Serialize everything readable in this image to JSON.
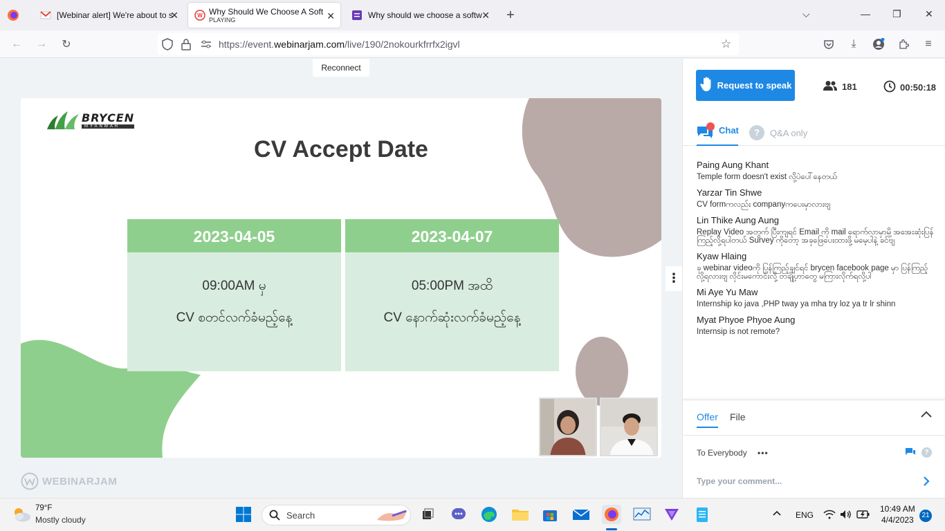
{
  "browser": {
    "tabs": [
      {
        "title": "[Webinar alert] We're about to s",
        "active": false
      },
      {
        "title": "Why Should We Choose A Softw",
        "subtitle": "PLAYING",
        "active": true
      },
      {
        "title": "Why should we choose a softw",
        "active": false
      }
    ],
    "url_prefix": "https://event.",
    "url_domain": "webinarjam.com",
    "url_path": "/live/190/2nokourkfrrfx2igvl"
  },
  "page": {
    "reconnect_label": "Reconnect",
    "slide": {
      "logo_text": "BRYCEN",
      "logo_sub": "MYANMAR",
      "title": "CV Accept Date",
      "boxes": [
        {
          "date": "2023-04-05",
          "line1": "09:00AM မှ",
          "line2": "CV စတင်လက်ခံမည့်နေ့"
        },
        {
          "date": "2023-04-07",
          "line1": "05:00PM အထိ",
          "line2": "CV နောက်ဆုံးလက်ခံမည့်နေ့"
        }
      ]
    },
    "watermark": "WEBINARJAM"
  },
  "panel": {
    "speak_label": "Request to speak",
    "attendee_count": "181",
    "timer": "00:50:18",
    "chat_tab": "Chat",
    "qa_tab": "Q&A only",
    "messages": [
      {
        "name": "Paing Aung Khant",
        "text": "Temple form doesn't exist လို့ပဲပေါ်နေတယ်"
      },
      {
        "name": "Yarzar Tin Shwe",
        "text": "CV formကလည်း companyကပေးမှာလားဗျ"
      },
      {
        "name": "Lin Thike Aung Aung",
        "text": "Replay Video အတွက် ပြီးကျရင် Email ကို mail ရောက်လာမှာမို့ အအေးဆုံးပြန်ကြည့်လို့ရပါတယ် Survey ကိုတော့ အခုဖြေပေးထားဖို့ မမေ့ပါနဲ့ ခင်ဗျ"
      },
      {
        "name": "Kyaw Hlaing",
        "text": "ခု webinar videoကို ပြန်ကြည့်ချင်ရင် brycen facebook page မှာ ပြန်ကြည့်လို့ရလားဗျ လိုင်းမကောင်းလို့ တချို့ဟာတွေ မကြားလိုက်ရလို့ပါ"
      },
      {
        "name": "Mi Aye Yu Maw",
        "text": "Internship ko java ,PHP tway ya mha try loz ya tr lr shinn"
      },
      {
        "name": "Myat Phyoe Phyoe Aung",
        "text": "Internsip is not remote?"
      }
    ],
    "offer_tab": "Offer",
    "file_tab": "File",
    "to_everybody": "To Everybody",
    "comment_placeholder": "Type your comment..."
  },
  "taskbar": {
    "weather_temp": "79°F",
    "weather_desc": "Mostly cloudy",
    "search_label": "Search",
    "lang": "ENG",
    "time": "10:49 AM",
    "date": "4/4/2023",
    "notification_count": "21"
  },
  "colors": {
    "accent": "#1e88e5",
    "slide_green": "#8fcf8d",
    "slide_box": "#d9ece0",
    "blob_mauve": "#b9aaa8"
  }
}
